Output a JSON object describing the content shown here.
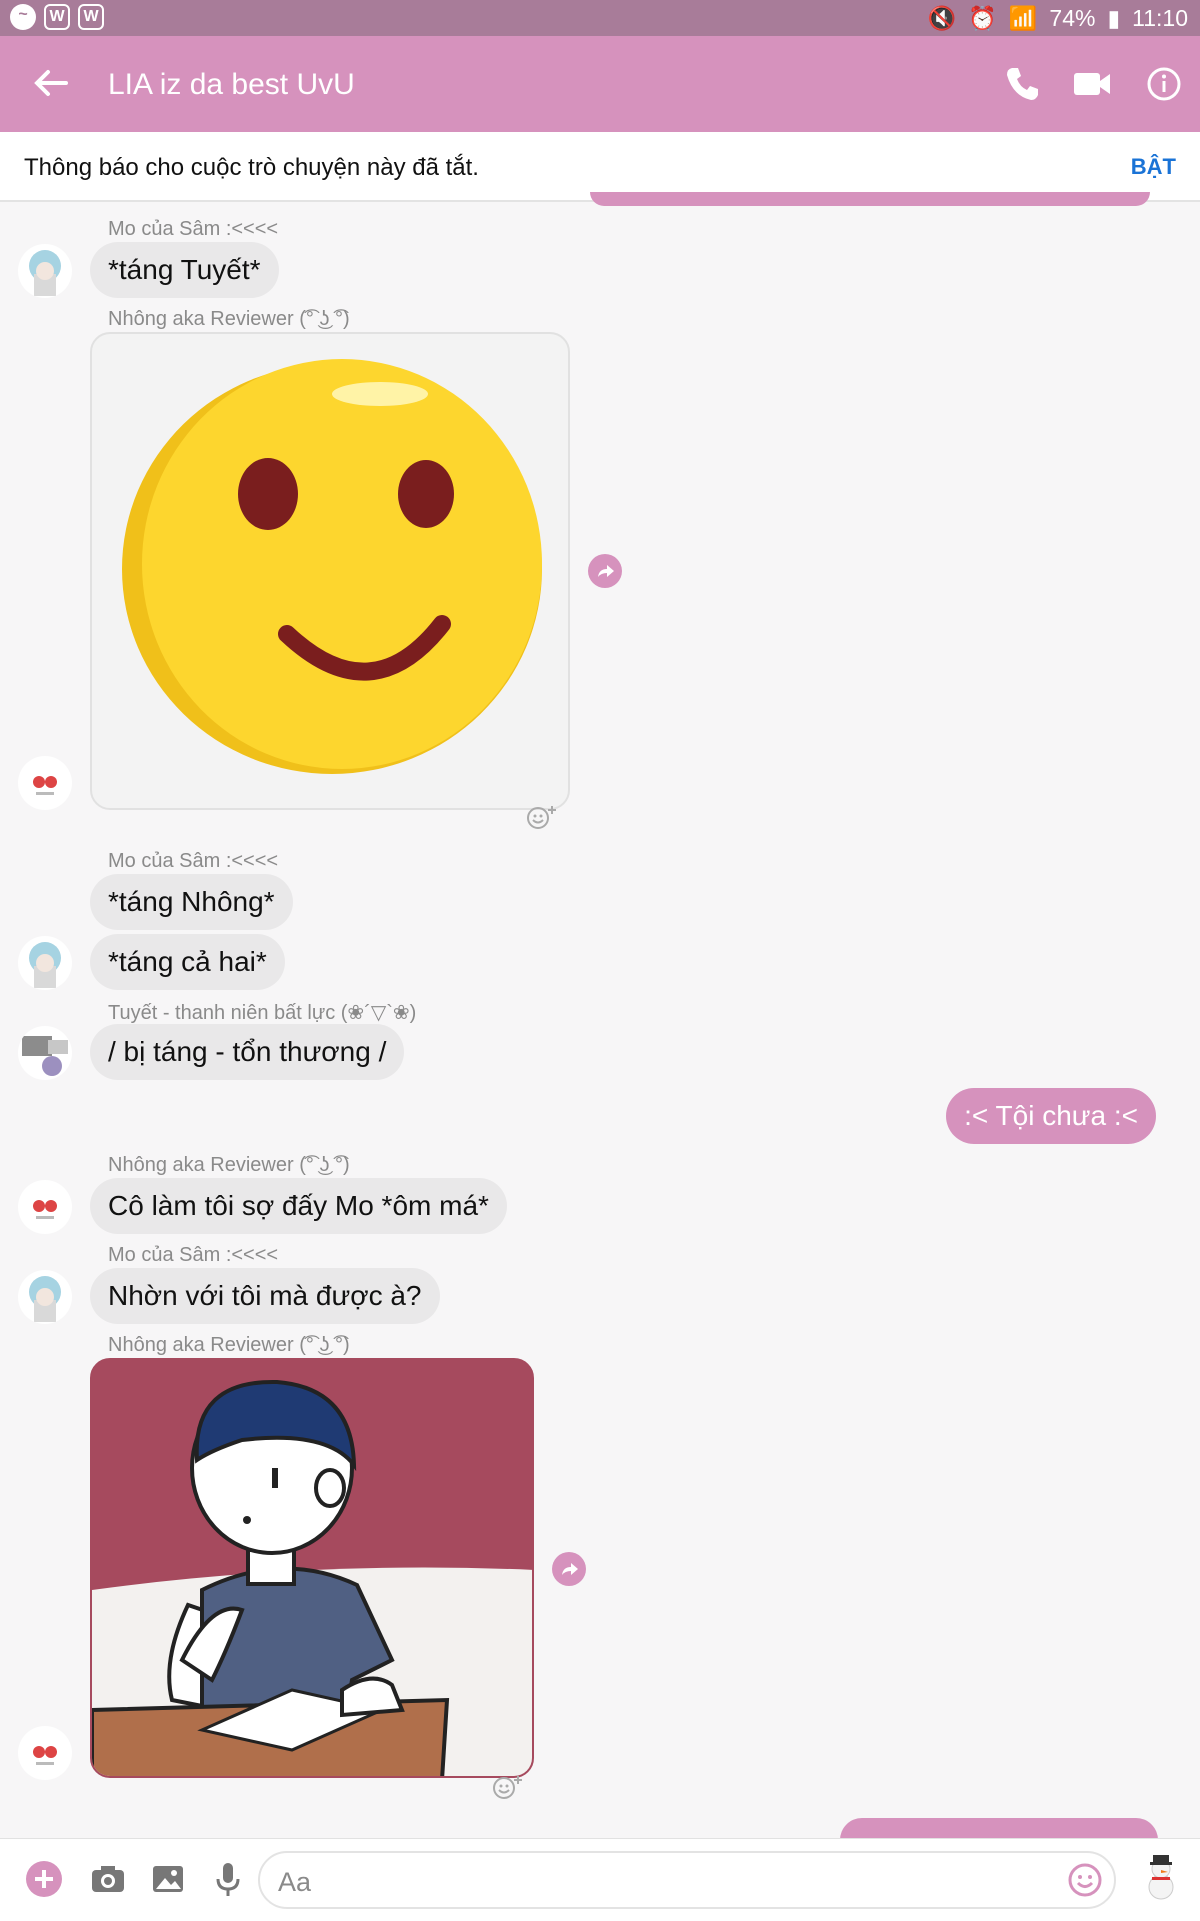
{
  "status_bar": {
    "battery": "74%",
    "time": "11:10",
    "left_icons": [
      "messenger-icon",
      "w-app-icon",
      "w-app-icon"
    ]
  },
  "header": {
    "title": "LIA iz da best UvU",
    "actions": [
      "phone-icon",
      "video-camera-icon",
      "info-icon"
    ]
  },
  "notice": {
    "text": "Thông báo cho cuộc trò chuyện này đã tắt.",
    "action": "BẬT"
  },
  "messages": [
    {
      "sender": "Mo của Sâm :<<<<",
      "text": "*táng Tuyết*"
    },
    {
      "sender": "Nhông aka Reviewer (͡° ͜ʖ ͡°)",
      "image": "smiling-emoji-sticker"
    },
    {
      "sender": "Mo của Sâm :<<<<",
      "text": "*táng Nhông*"
    },
    {
      "text": "*táng cả hai*"
    },
    {
      "sender": "Tuyết - thanh niên bất lực (❀´▽`❀)",
      "text": "/ bị táng - tổn thương /"
    },
    {
      "mine": true,
      "text": ":< Tội chưa :<"
    },
    {
      "sender": "Nhông aka Reviewer (͡° ͜ʖ ͡°)",
      "text": "Cô làm tôi sợ đấy Mo *ôm má*"
    },
    {
      "sender": "Mo của Sâm :<<<<",
      "text": "Nhờn với tôi mà được à?"
    },
    {
      "sender": "Nhông aka Reviewer (͡° ͜ʖ ͡°)",
      "image": "boy-at-desk-sticker"
    }
  ],
  "composer": {
    "placeholder": "Aa"
  },
  "colors": {
    "accent": "#d692bd",
    "status_bar": "#a87c99",
    "bubble_other": "#e9e8e9",
    "link_blue": "#1a73d6"
  }
}
